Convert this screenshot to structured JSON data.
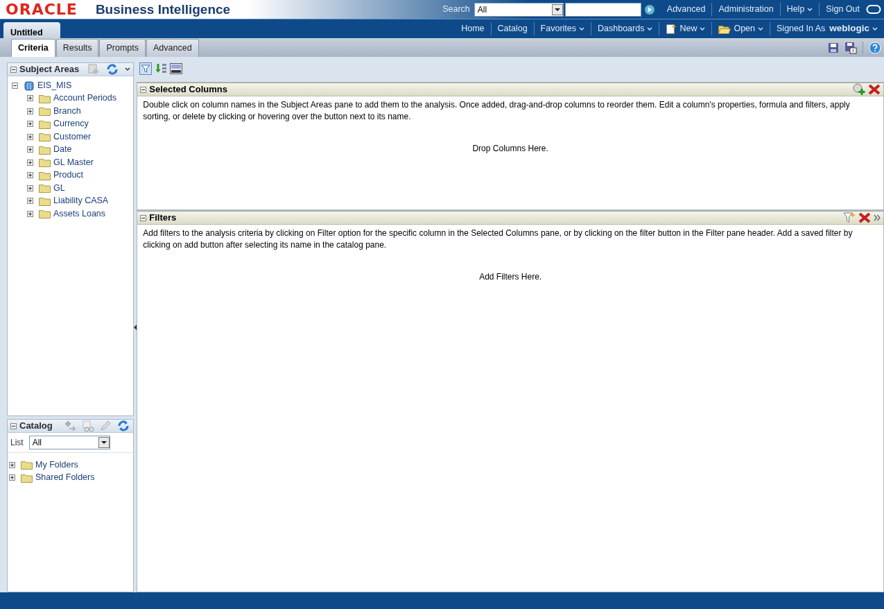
{
  "header": {
    "logo": "ORACLE",
    "product": "Business Intelligence",
    "search_label": "Search",
    "search_scope": "All",
    "links": [
      {
        "label": "Advanced",
        "dropdown": false
      },
      {
        "label": "Administration",
        "dropdown": false
      },
      {
        "label": "Help",
        "dropdown": true
      },
      {
        "label": "Sign Out",
        "dropdown": false
      }
    ]
  },
  "nav": {
    "items": [
      {
        "label": "Home",
        "kind": "link"
      },
      {
        "label": "Catalog",
        "kind": "link"
      },
      {
        "label": "Favorites",
        "kind": "menu"
      },
      {
        "label": "Dashboards",
        "kind": "menu"
      },
      {
        "label": "New",
        "kind": "new"
      },
      {
        "label": "Open",
        "kind": "open"
      }
    ],
    "signed_in_label": "Signed In As",
    "user": "weblogic"
  },
  "document_tab": "Untitled",
  "tabs": [
    {
      "label": "Criteria",
      "selected": true
    },
    {
      "label": "Results",
      "selected": false
    },
    {
      "label": "Prompts",
      "selected": false
    },
    {
      "label": "Advanced",
      "selected": false
    }
  ],
  "subject_areas": {
    "title": "Subject Areas",
    "tree": [
      {
        "label": "EIS_MIS",
        "expanded": true,
        "children": [
          {
            "label": "Account Periods",
            "expanded": false
          },
          {
            "label": "Branch",
            "expanded": false
          },
          {
            "label": "Currency",
            "expanded": false
          },
          {
            "label": "Customer",
            "expanded": false
          },
          {
            "label": "Date",
            "expanded": false
          },
          {
            "label": "GL Master",
            "expanded": false
          },
          {
            "label": "Product",
            "expanded": false
          },
          {
            "label": "GL",
            "expanded": false
          },
          {
            "label": "Liability CASA",
            "expanded": false
          },
          {
            "label": "Assets Loans",
            "expanded": false
          }
        ]
      }
    ]
  },
  "catalog": {
    "title": "Catalog",
    "list_label": "List",
    "list_value": "All",
    "tree": [
      {
        "label": "My Folders",
        "expanded": false
      },
      {
        "label": "Shared Folders",
        "expanded": false
      }
    ]
  },
  "selected_columns": {
    "title": "Selected Columns",
    "help": "Double click on column names in the Subject Areas pane to add them to the analysis. Once added, drag-and-drop columns to reorder them. Edit a column's properties, formula and filters, apply sorting, or delete by clicking or hovering over the button next to its name.",
    "drop_text": "Drop Columns Here."
  },
  "filters": {
    "title": "Filters",
    "help": "Add filters to the analysis criteria by clicking on Filter option for the specific column in the Selected Columns pane, or by clicking on the filter button in the Filter pane header. Add a saved filter by clicking on add button after selecting its name in the catalog pane.",
    "drop_text": "Add Filters Here."
  }
}
